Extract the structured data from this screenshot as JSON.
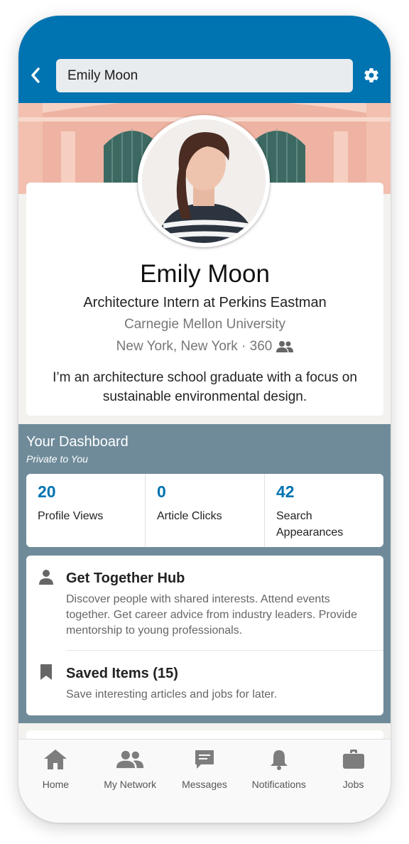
{
  "header": {
    "search_value": "Emily Moon",
    "accent_color": "#0073b1"
  },
  "profile": {
    "name": "Emily Moon",
    "headline": "Architecture Intern at Perkins Eastman",
    "school": "Carnegie Mellon University",
    "location": "New York, New York · 360",
    "connections_icon": "people-icon",
    "bio": "I’m an architecture school graduate with a focus on sustainable environmental design."
  },
  "dashboard": {
    "title": "Your Dashboard",
    "subtitle": "Private to You",
    "stats": [
      {
        "value": "20",
        "label": "Profile Views"
      },
      {
        "value": "0",
        "label": "Article Clicks"
      },
      {
        "value": "42",
        "label": "Search Appearances"
      }
    ],
    "items": [
      {
        "title": "Get Together Hub",
        "icon": "person-icon",
        "description": "Discover people with shared interests. Attend events together. Get career advice from industry leaders. Provide mentorship to young professionals."
      },
      {
        "title": "Saved Items (15)",
        "icon": "bookmark-icon",
        "description": "Save interesting articles and jobs for later."
      }
    ]
  },
  "bottom_nav": [
    {
      "label": "Home",
      "icon": "home-icon"
    },
    {
      "label": "My Network",
      "icon": "network-icon"
    },
    {
      "label": "Messages",
      "icon": "messages-icon"
    },
    {
      "label": "Notifications",
      "icon": "bell-icon"
    },
    {
      "label": "Jobs",
      "icon": "briefcase-icon"
    }
  ]
}
